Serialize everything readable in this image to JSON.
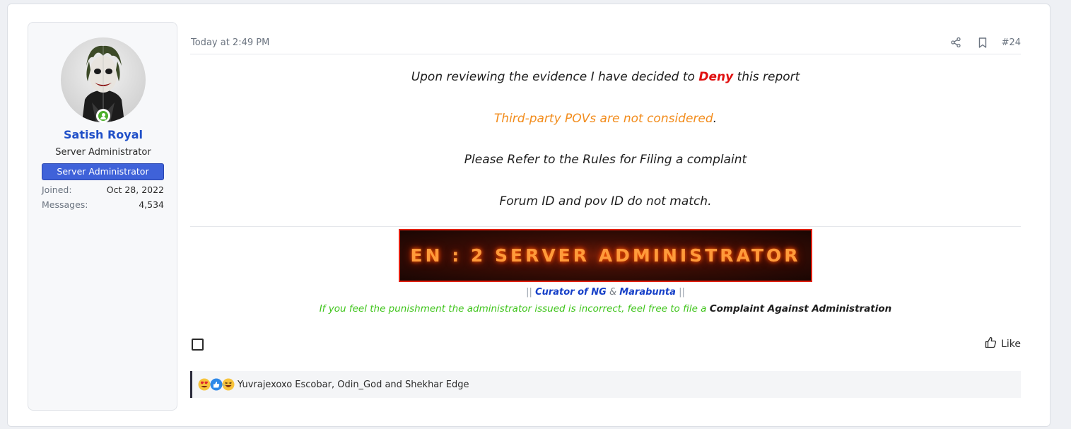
{
  "user": {
    "name": "Satish Royal",
    "title": "Server Administrator",
    "banner": "Server Administrator",
    "stats": [
      {
        "label": "Joined:",
        "value": "Oct 28, 2022"
      },
      {
        "label": "Messages:",
        "value": "4,534"
      }
    ],
    "online": true
  },
  "post": {
    "timestamp": "Today at 2:49 PM",
    "post_number": "#24",
    "icons": [
      "share-icon",
      "bookmark-icon"
    ],
    "body": {
      "line1_pre": "Upon reviewing the evidence I have decided to ",
      "line1_deny": "Deny",
      "line1_post": " this report",
      "line2_orange": "Third-party POVs are not considered",
      "line2_dot": ".",
      "line3": "Please Refer to the Rules for Filing a complaint",
      "line4": "Forum ID and pov ID do not match."
    },
    "colors": {
      "deny": "#e01010",
      "orange_text": "#f28c1c",
      "username": "#2050c8",
      "banner": "#3f62d9",
      "signature_green": "#3ec41a"
    }
  },
  "signature": {
    "banner_text": "EN : 2 SERVER ADMINISTRATOR",
    "pipe_open": "||",
    "curator": "Curator of NG",
    "amp": "&",
    "marabunta": "Marabunta",
    "pipe_close": "||",
    "notice": "If you feel the punishment the administrator issued is incorrect, feel free to file a ",
    "notice_link": "Complaint Against Administration"
  },
  "actions": {
    "like_label": "Like"
  },
  "reactions": {
    "icons": [
      "heart-eyes-icon",
      "like-reaction-icon",
      "laugh-icon"
    ],
    "text": "Yuvrajexoxo Escobar, Odin_God and Shekhar Edge"
  }
}
